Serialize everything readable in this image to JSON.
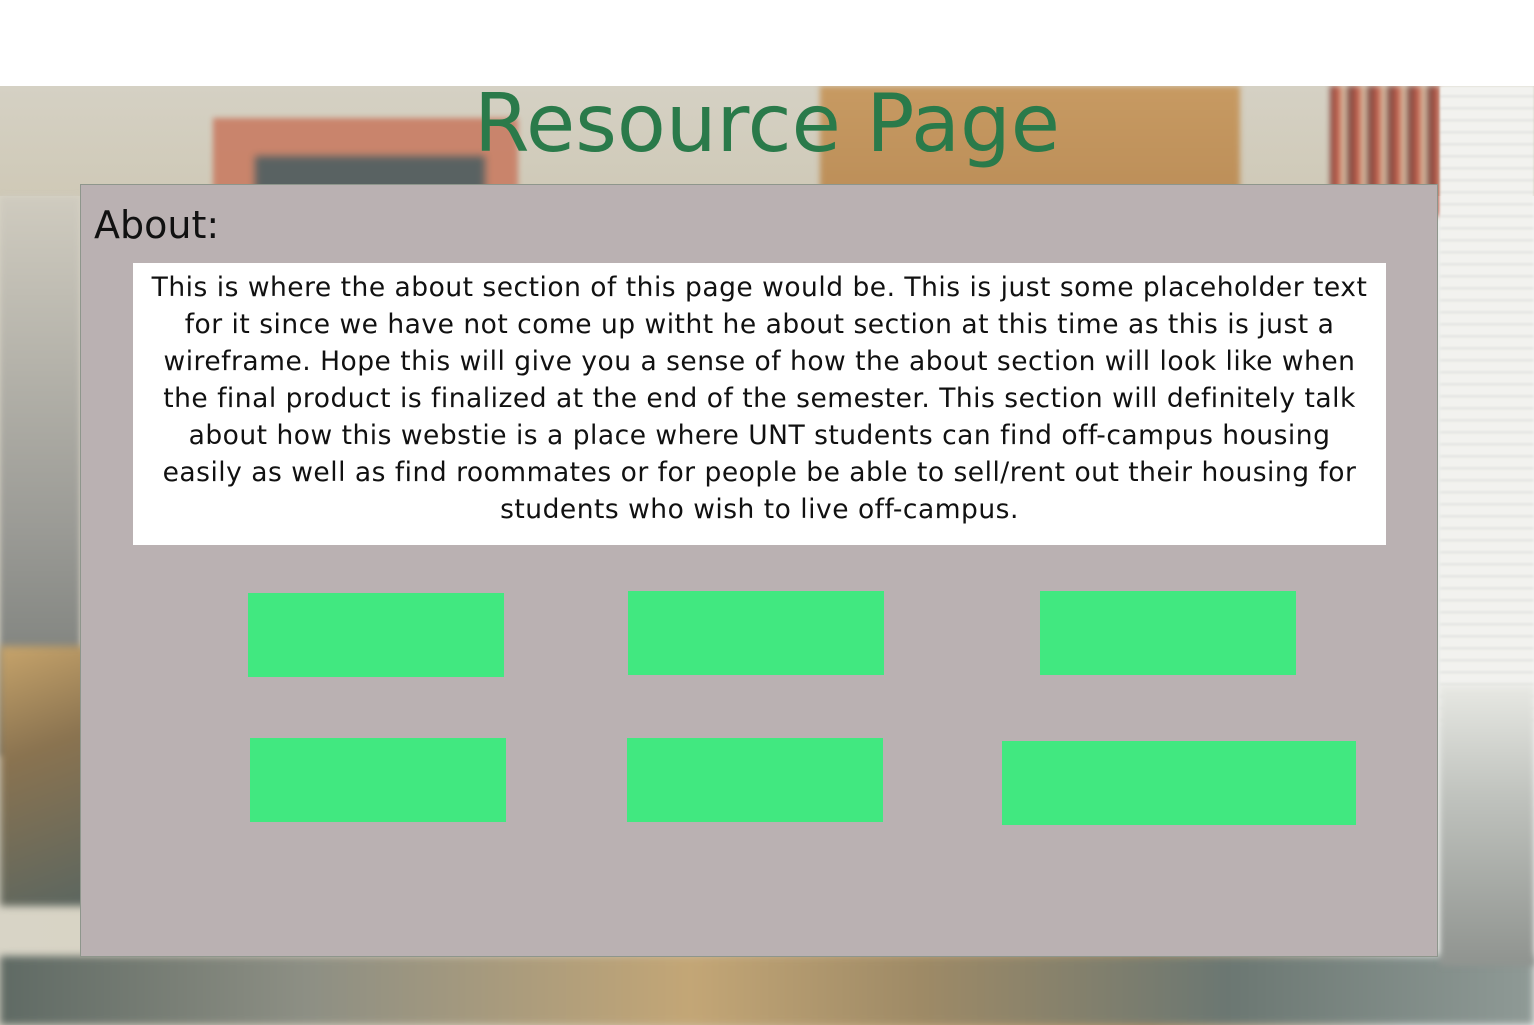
{
  "header": {
    "title": "Resource Page"
  },
  "about": {
    "heading": "About:",
    "body": "This is where the about section of this page would be. This is just some placeholder text for it since we have not come up witht he about section at this time as this is just a wireframe. Hope this will give you a sense of how the about section will look like when the final product is finalized at the end of the semester. This section will definitely talk about how this webstie is a place where UNT students can find off-campus housing easily as well as find roommates or for people be able to sell/rent out their housing for students who wish to live off-campus."
  },
  "resources": {
    "buttons": [
      {
        "label": ""
      },
      {
        "label": ""
      },
      {
        "label": ""
      },
      {
        "label": ""
      },
      {
        "label": ""
      },
      {
        "label": ""
      }
    ]
  },
  "colors": {
    "title": "#2a7a4a",
    "panel": "#bab1b2",
    "button": "#41e880",
    "about_box": "#ffffff"
  }
}
